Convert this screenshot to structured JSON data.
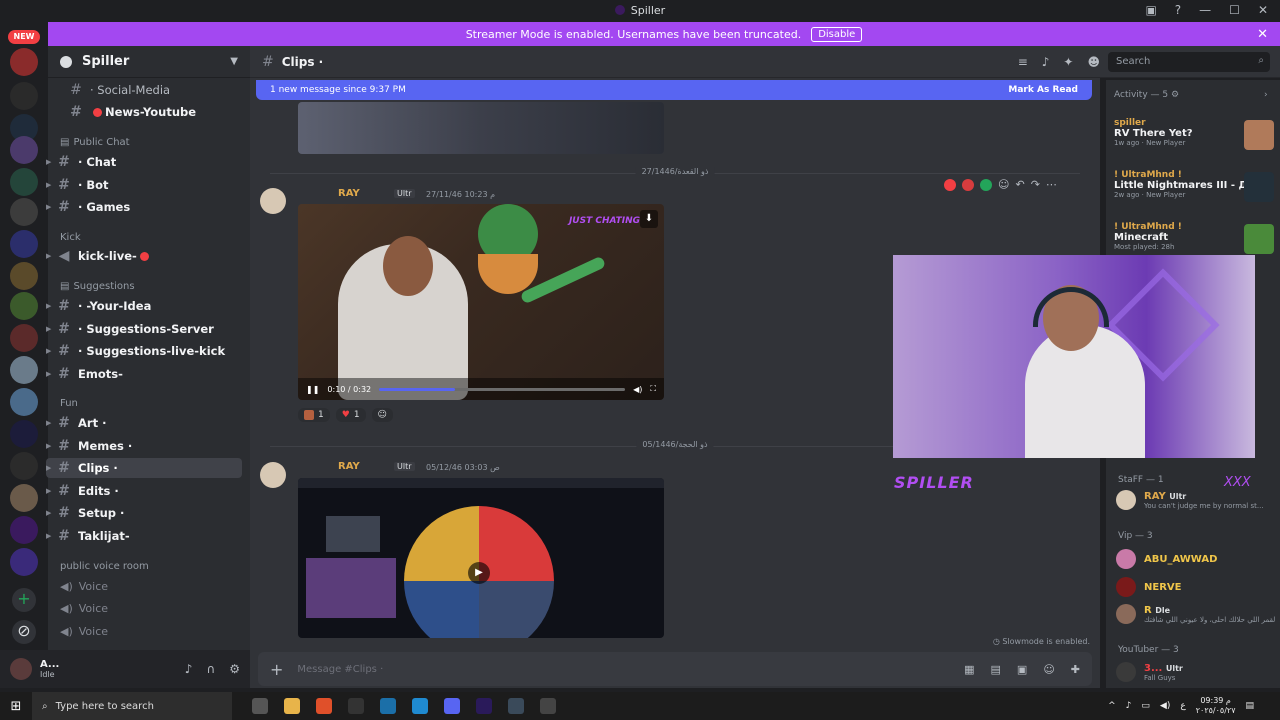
{
  "window": {
    "title": "Spiller"
  },
  "streamer": {
    "text": "Streamer Mode is enabled. Usernames have been truncated.",
    "disable": "Disable"
  },
  "guild": {
    "name": "Spiller"
  },
  "rail": {
    "new_badge": "NEW"
  },
  "channels": {
    "social": "· Social-Media",
    "news": "News-Youtube",
    "public_chat": "Public Chat",
    "chat": "· Chat",
    "bot": "· Bot",
    "games": "· Games",
    "kick": "Kick",
    "kick_live": "kick-live-",
    "suggestions": "Suggestions",
    "your_idea": "· -Your-Idea",
    "sugg_server": "· Suggestions-Server",
    "sugg_kick": "· Suggestions-live-kick",
    "emots": "Emots-",
    "fun": "Fun",
    "art": "Art ·",
    "memes": "Memes ·",
    "clips": "Clips ·",
    "edits": "Edits ·",
    "setup": "Setup ·",
    "taklijat": "Taklijat-",
    "voice_cat": "public voice room",
    "voice1": "Voice",
    "voice2": "Voice",
    "voice3": "Voice"
  },
  "user": {
    "name": "A...",
    "status": "Idle"
  },
  "header": {
    "channel": "Clips ·",
    "search_placeholder": "Search"
  },
  "new_messages": {
    "text": "1 new message since 9:37 PM",
    "mark": "Mark As Read"
  },
  "dates": {
    "d1": "27/1446/ذو القعدة",
    "d2": "05/1446/ذو الحجة"
  },
  "msg1": {
    "author": "RAY",
    "tag": "Ultr",
    "time": "27/11/46 10:23 م",
    "video_time": "0:10 / 0:32",
    "progress": 0.31,
    "overlay": "JUST CHATING",
    "reaction_count1": "1",
    "reaction_count2": "1"
  },
  "msg2": {
    "author": "RAY",
    "tag": "Ultr",
    "time": "05/12/46 03:03 ص"
  },
  "composer": {
    "placeholder": "Message #Clips ·",
    "slowmode": "Slowmode is enabled."
  },
  "activity": {
    "header": "Activity — 5",
    "items": [
      {
        "name": "spiller",
        "game": "RV There Yet?",
        "time": "1w ago",
        "tag": "New Player",
        "color": "#e0a94b"
      },
      {
        "name": "! UltraMhnd !",
        "game": "Little Nightmares III - Дем...",
        "time": "2w ago",
        "tag": "New Player",
        "color": "#e0a94b"
      },
      {
        "name": "! UltraMhnd !",
        "game": "Minecraft",
        "time": "Most played: 28h",
        "tag": "",
        "color": "#e0a94b"
      }
    ]
  },
  "overlay": {
    "spiller": "SPILLER",
    "xxx": "XXX"
  },
  "members": {
    "staff_cat": "StaFF — 1",
    "staff_name": "RAY",
    "staff_tag": "Ultr",
    "staff_sub": "You can't judge me by normal st...",
    "vip_cat": "Vip — 3",
    "vip1": "ABU_AWWAD",
    "vip2": "NERVE",
    "vip3": "R",
    "vip3_tag": "Dle",
    "vip3_sub": "لقمر اللي حلالك احلى، ولا عيوني اللي شافتك",
    "yt_cat": "YouTuber — 3",
    "yt1": "3...",
    "yt1_tag": "Ultr",
    "yt1_sub": "Fall Guys"
  },
  "taskbar": {
    "search": "Type here to search",
    "time": "09:39 م",
    "date": "٢٠٢٥/٠٥/٢٧",
    "lang": "ع"
  }
}
